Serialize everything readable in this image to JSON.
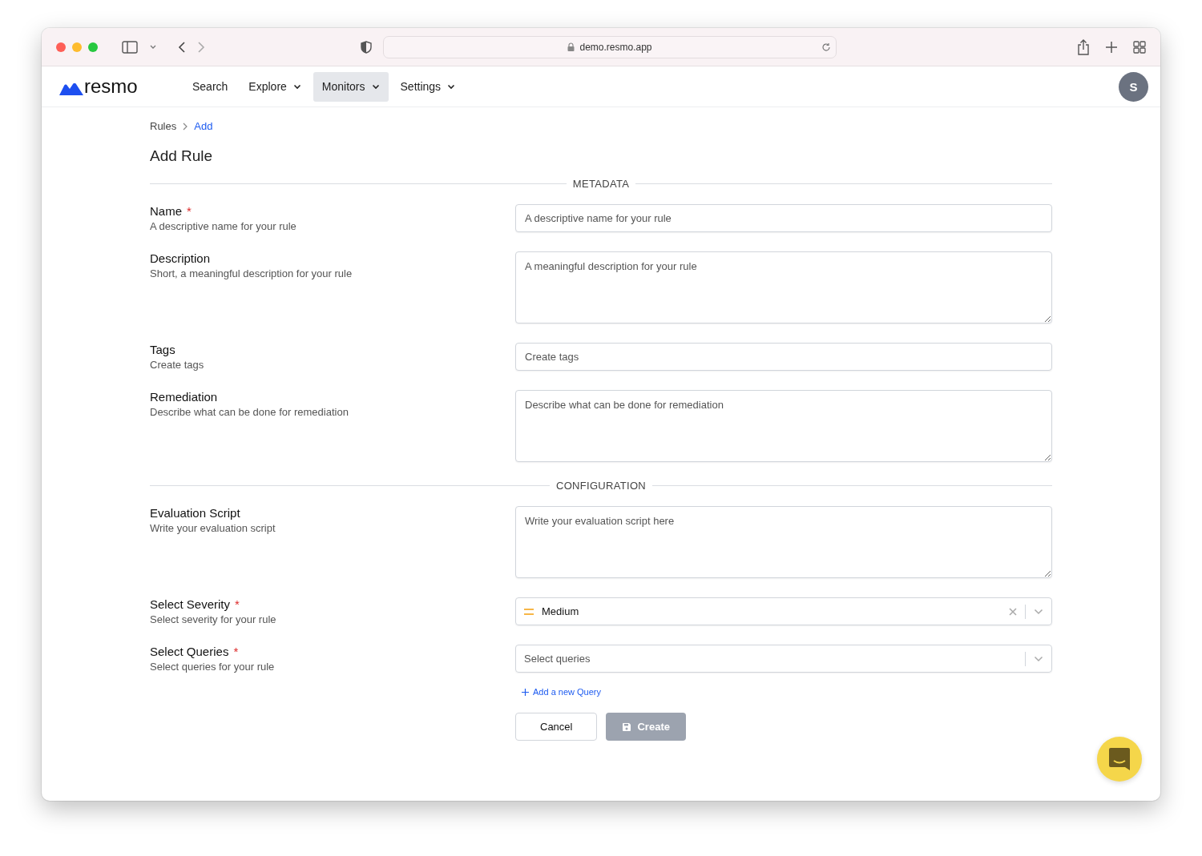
{
  "browser": {
    "address": "demo.resmo.app"
  },
  "nav": {
    "logo": "resmo",
    "items": [
      {
        "label": "Search",
        "dropdown": false,
        "selected": false
      },
      {
        "label": "Explore",
        "dropdown": true,
        "selected": false
      },
      {
        "label": "Monitors",
        "dropdown": true,
        "selected": true
      },
      {
        "label": "Settings",
        "dropdown": true,
        "selected": false
      }
    ],
    "avatar": "S"
  },
  "breadcrumb": [
    {
      "label": "Rules",
      "current": false
    },
    {
      "label": "Add",
      "current": true
    }
  ],
  "title": "Add Rule",
  "sections": [
    {
      "heading": "METADATA",
      "fields": [
        {
          "kind": "input",
          "label": "Name",
          "required_mark": "*",
          "help": "A descriptive name for your rule",
          "placeholder": "A descriptive name for your rule"
        },
        {
          "kind": "textarea",
          "label": "Description",
          "help": "Short, a meaningful description for your rule",
          "placeholder": "A meaningful description for your rule"
        },
        {
          "kind": "input",
          "label": "Tags",
          "help": "Create tags",
          "placeholder": "Create tags"
        },
        {
          "kind": "textarea",
          "label": "Remediation",
          "help": "Describe what can be done for remediation",
          "placeholder": "Describe what can be done for remediation"
        }
      ]
    },
    {
      "heading": "CONFIGURATION",
      "fields": [
        {
          "kind": "textarea",
          "label": "Evaluation Script",
          "help": "Write your evaluation script",
          "placeholder": "Write your evaluation script here"
        },
        {
          "kind": "select",
          "label": "Select Severity",
          "required_mark": "*",
          "help": "Select severity for your rule",
          "value": "Medium",
          "clearable": true
        },
        {
          "kind": "select",
          "label": "Select Queries",
          "required_mark": "*",
          "help": "Select queries for your rule",
          "placeholder": "Select queries",
          "clearable": false,
          "link": "Add a new Query"
        }
      ]
    }
  ],
  "actions": [
    {
      "label": "Cancel",
      "kind": "secondary",
      "disabled": false
    },
    {
      "label": "Create",
      "kind": "primary",
      "disabled": true
    }
  ]
}
